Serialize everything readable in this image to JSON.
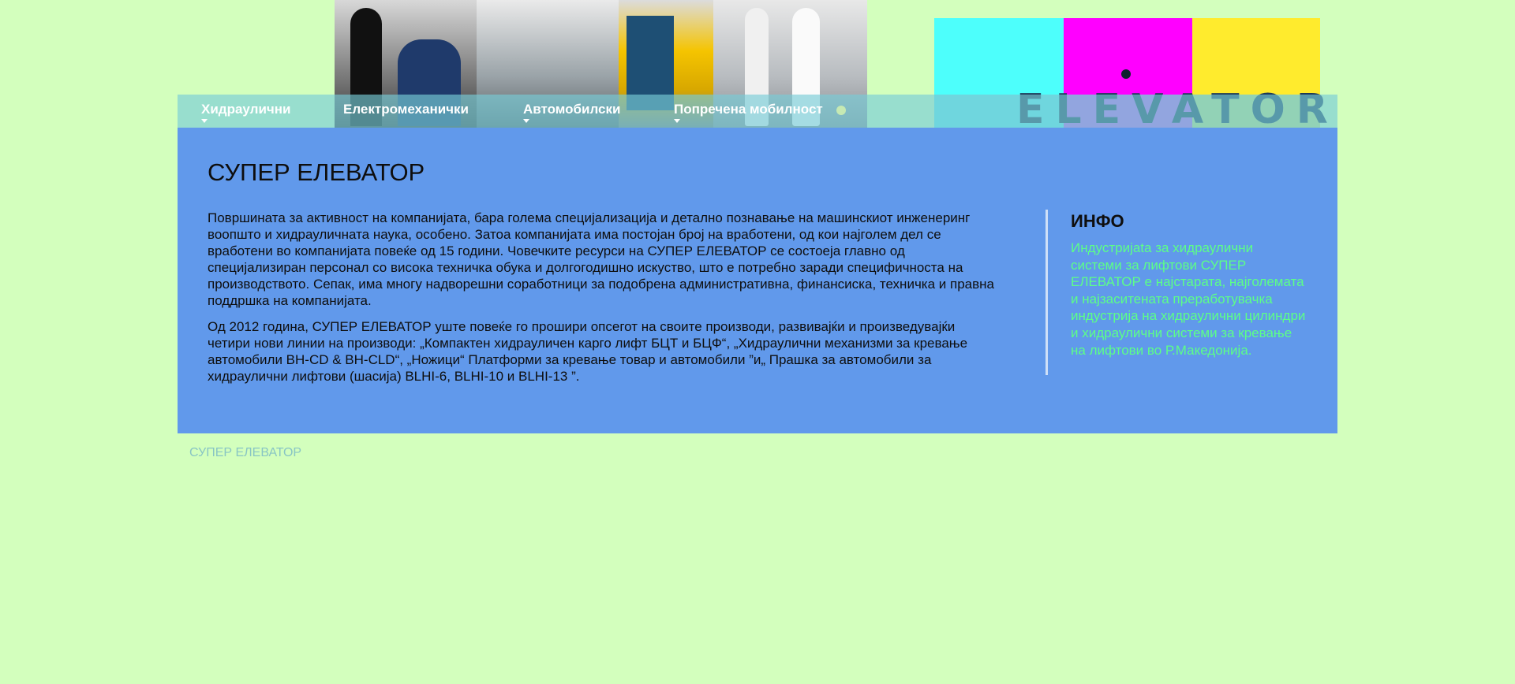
{
  "nav": {
    "items": [
      {
        "label": "Хидраулични",
        "has_dropdown": true
      },
      {
        "label": "Електромеханички",
        "has_dropdown": false
      },
      {
        "label": "Автомобилски",
        "has_dropdown": true
      },
      {
        "label": "Попречена мобилност",
        "has_dropdown": true
      }
    ]
  },
  "logo": {
    "text": "ELEVATOR",
    "colors": [
      "#4dfffc",
      "#ff00ff",
      "#ffeb2d"
    ],
    "text_color": "#1e3a58"
  },
  "main": {
    "title": "СУПЕР ЕЛЕВАТОР",
    "paragraphs": [
      "Површината за активност на компанијата, бара голема специјализација и детално познавање на машинскиот инженеринг воопшто и хидрауличната наука, особено. Затоа компанијата има постојан број на вработени, од кои најголем дел се вработени во компанијата повеќе од 15 години. Човечките ресурси на СУПЕР ЕЛЕВАТОР се состоеја главно од специјализиран персонал со висока техничка обука и долгогодишно искуство, што е потребно заради специфичноста на производството. Сепак, има многу надворешни соработници за подобрена административна, финансиска, техничка и правна поддршка на компанијата.",
      "Од 2012 година, СУПЕР ЕЛЕВАТОР уште повеќе го прошири опсегот на своите производи, развивајќи и произведувајќи четири нови линии на производи: „Компактен хидрауличен карго лифт БЦТ и БЦФ“, „Хидраулични механизми за кревање автомобили BH-CD & BH-CLD“, „Ножици“ Платформи за кревање товар и автомобили ”и„ Прашка за автомобили за хидраулични лифтови (шасија) BLHI-6, BLHI-10 и BLHI-13 ”."
    ]
  },
  "info": {
    "title": "ИНФО",
    "text": "Индустријata за хидраулични системи за лифтови СУПЕР ЕЛЕВАТОР е најстарата, најголемата и најзаситената преработувачка индустрија на хидраулични цилиндри и хидраулични системи за кревање на лифтови во Р.Македонија."
  },
  "footer": {
    "text": "СУПЕР ЕЛЕВАТОР"
  },
  "colors": {
    "page_bg": "#d3ffbd",
    "main_bg": "#6199eb",
    "info_text": "#5cff87",
    "footer_text": "#88c5c4"
  }
}
